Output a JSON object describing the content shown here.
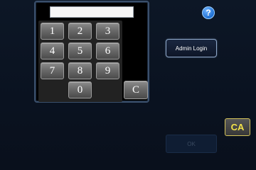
{
  "keypad": {
    "keys": [
      "1",
      "2",
      "3",
      "4",
      "5",
      "6",
      "7",
      "8",
      "9",
      "0"
    ],
    "clear_label": "C"
  },
  "help": {
    "label": "?"
  },
  "admin_login": {
    "label": "Admin Login"
  },
  "ca_button": {
    "label": "CA"
  },
  "ok_button": {
    "label": "OK",
    "state": "disabled"
  },
  "colors": {
    "background": "#0b1422",
    "panel_border": "#3a4f6b",
    "ca_text": "#f2e24a",
    "help_blue": "#1f6fd1"
  }
}
